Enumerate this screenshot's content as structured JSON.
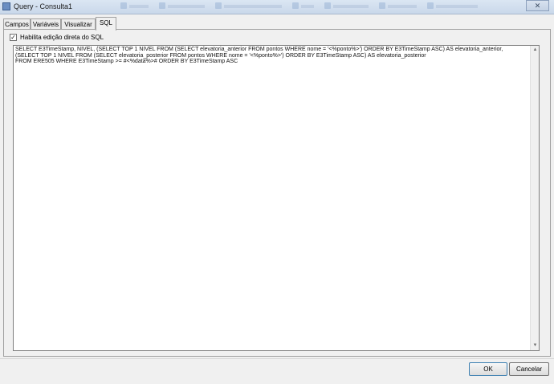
{
  "window": {
    "title": "Query - Consulta1",
    "close_label": "✕"
  },
  "tabs": [
    {
      "label": "Campos"
    },
    {
      "label": "Variáveis"
    },
    {
      "label": "Visualizar"
    },
    {
      "label": "SQL"
    }
  ],
  "active_tab": "SQL",
  "options": {
    "direct_edit_label": "Habilita edição direta do SQL",
    "direct_edit_checked": true,
    "check_glyph": "✓"
  },
  "sql": {
    "text": "SELECT E3TimeStamp, NIVEL, (SELECT TOP 1 NIVEL FROM (SELECT elevatoria_anterior FROM pontos WHERE nome = '<%ponto%>') ORDER BY E3TimeStamp ASC) AS elevatoria_anterior,\n(SELECT TOP 1 NIVEL FROM (SELECT elevatoria_posterior FROM pontos WHERE nome = '<%ponto%>') ORDER BY E3TimeStamp ASC) AS elevatoria_posterior\nFROM ERE505 WHERE E3TimeStamp >= #<%data%># ORDER BY E3TimeStamp ASC"
  },
  "scrollbar": {
    "up_icon": "▲",
    "down_icon": "▼"
  },
  "buttons": {
    "ok_label": "OK",
    "cancel_label": "Cancelar"
  }
}
